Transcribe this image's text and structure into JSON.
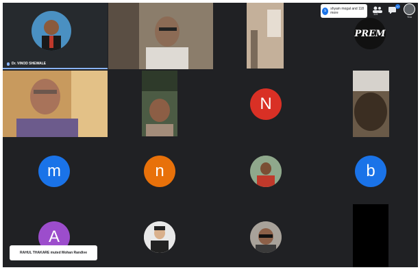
{
  "meeting": {
    "participants_toast": "shyam mogal and 118 more",
    "participants_avatar": "s",
    "people_count": "119",
    "chat_badge": "10",
    "self_view_label": "You"
  },
  "tiles": [
    {
      "type": "video",
      "name": "Dr. VINOD SHEWALE",
      "speaking": true
    },
    {
      "type": "video",
      "name": ""
    },
    {
      "type": "video",
      "name": ""
    },
    {
      "type": "logo",
      "name": "",
      "logo_text": "PREM"
    },
    {
      "type": "video",
      "name": ""
    },
    {
      "type": "video",
      "name": ""
    },
    {
      "type": "letter",
      "letter": "N",
      "color": "#d93025"
    },
    {
      "type": "video",
      "name": ""
    },
    {
      "type": "letter",
      "letter": "m",
      "color": "#1a73e8"
    },
    {
      "type": "letter",
      "letter": "n",
      "color": "#e8710a"
    },
    {
      "type": "photo",
      "name": ""
    },
    {
      "type": "letter",
      "letter": "b",
      "color": "#1a73e8"
    },
    {
      "type": "letter",
      "letter": "A",
      "color": "#9c4dcc"
    },
    {
      "type": "photo",
      "name": ""
    },
    {
      "type": "photo",
      "name": ""
    },
    {
      "type": "video",
      "name": ""
    }
  ],
  "toast": "RAHUL THAKARE muted Mohan Randive"
}
